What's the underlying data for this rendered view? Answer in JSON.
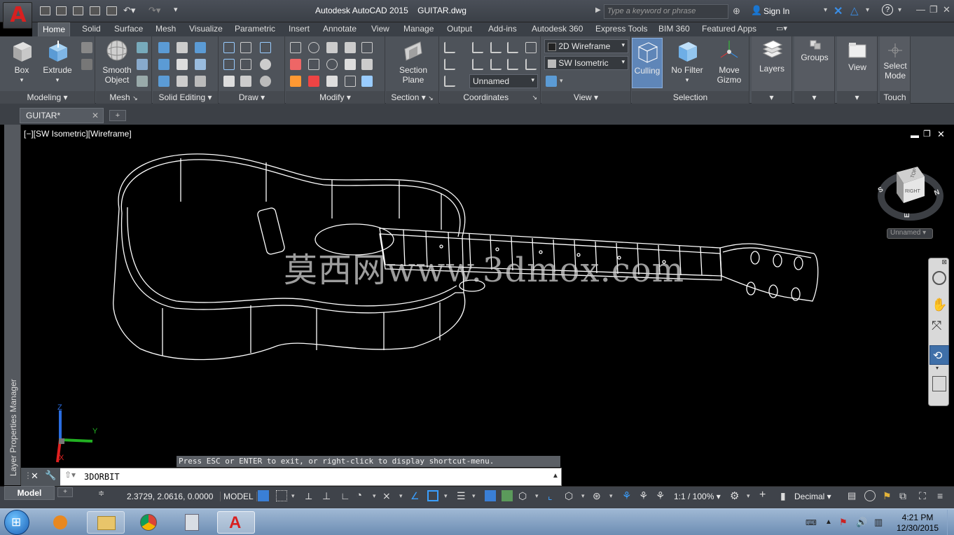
{
  "title_bar": {
    "app_title": "Autodesk AutoCAD 2015",
    "file_name": "GUITAR.dwg",
    "search_placeholder": "Type a keyword or phrase",
    "sign_in": "Sign In"
  },
  "ribbon_tabs": [
    "Home",
    "Solid",
    "Surface",
    "Mesh",
    "Visualize",
    "Parametric",
    "Insert",
    "Annotate",
    "View",
    "Manage",
    "Output",
    "Add-ins",
    "Autodesk 360",
    "Express Tools",
    "BIM 360",
    "Featured Apps"
  ],
  "ribbon": {
    "modeling": {
      "label": "Modeling",
      "box": "Box",
      "extrude": "Extrude"
    },
    "mesh": {
      "label": "Mesh",
      "smooth_object_1": "Smooth",
      "smooth_object_2": "Object"
    },
    "solid_editing": {
      "label": "Solid Editing"
    },
    "draw": {
      "label": "Draw"
    },
    "modify": {
      "label": "Modify"
    },
    "section": {
      "label": "Section",
      "section_plane_1": "Section",
      "section_plane_2": "Plane"
    },
    "coordinates": {
      "label": "Coordinates",
      "ucs_value": "Unnamed"
    },
    "view": {
      "label": "View",
      "visual_style": "2D Wireframe",
      "view_preset": "SW Isometric"
    },
    "selection": {
      "label": "Selection",
      "culling": "Culling",
      "no_filter": "No Filter",
      "move_gizmo_1": "Move",
      "move_gizmo_2": "Gizmo"
    },
    "layers": "Layers",
    "groups": "Groups",
    "view_btn": "View",
    "touch": {
      "label": "Touch",
      "select_mode_1": "Select",
      "select_mode_2": "Mode"
    }
  },
  "document_tab": "GUITAR*",
  "side_palette": "Layer Properties Manager",
  "viewport": {
    "label": "[−][SW Isometric][Wireframe]",
    "viewcube_face": "RIGHT",
    "viewcube_top": "TOP",
    "compass": {
      "s": "S",
      "n": "N",
      "e": "E"
    },
    "ucs_name": "Unnamed",
    "axis": {
      "x": "X",
      "y": "Y",
      "z": "Z"
    },
    "watermark": "莫西网www.3dmox.com"
  },
  "command": {
    "hint": "Press ESC or ENTER to exit, or right-click to display shortcut-menu.",
    "current": "3DORBIT"
  },
  "status_bar": {
    "layout_tab": "Model",
    "coordinates": "2.3729, 2.0616, 0.0000",
    "model_toggle": "MODEL",
    "scale": "1:1 / 100%",
    "units": "Decimal"
  },
  "taskbar": {
    "time": "4:21 PM",
    "date": "12/30/2015"
  },
  "colors": {
    "ribbon_bg": "#4e535a",
    "title_bg": "#3b4047",
    "viewport_bg": "#000000",
    "autocad_red": "#d82020",
    "highlight_blue": "#3f6fa8"
  }
}
